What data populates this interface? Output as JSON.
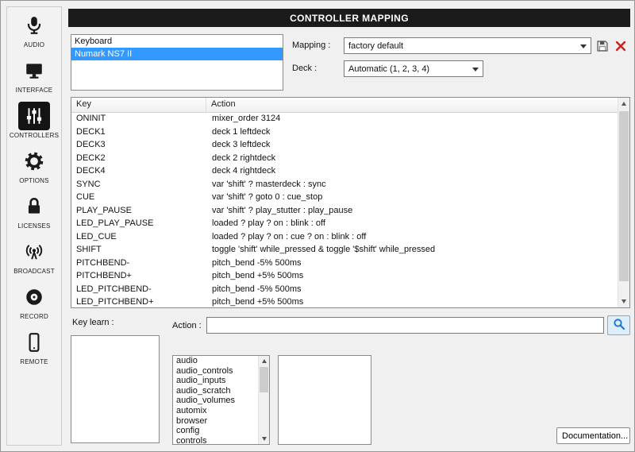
{
  "header": {
    "title": "CONTROLLER MAPPING"
  },
  "sidebar": {
    "items": [
      {
        "label": "AUDIO",
        "icon": "microphone-icon",
        "selected": false
      },
      {
        "label": "INTERFACE",
        "icon": "monitor-icon",
        "selected": false
      },
      {
        "label": "CONTROLLERS",
        "icon": "mixer-sliders-icon",
        "selected": true
      },
      {
        "label": "OPTIONS",
        "icon": "gear-icon",
        "selected": false
      },
      {
        "label": "LICENSES",
        "icon": "lock-icon",
        "selected": false
      },
      {
        "label": "BROADCAST",
        "icon": "broadcast-icon",
        "selected": false
      },
      {
        "label": "RECORD",
        "icon": "record-icon",
        "selected": false
      },
      {
        "label": "REMOTE",
        "icon": "smartphone-icon",
        "selected": false
      }
    ]
  },
  "devices": {
    "items": [
      {
        "label": "Keyboard",
        "selected": false
      },
      {
        "label": "Numark NS7 II",
        "selected": true
      }
    ]
  },
  "mapping": {
    "label": "Mapping :",
    "value": "factory default"
  },
  "deck": {
    "label": "Deck :",
    "value": "Automatic (1, 2, 3, 4)"
  },
  "table": {
    "columns": [
      "Key",
      "Action"
    ],
    "rows": [
      {
        "key": "ONINIT",
        "action": "mixer_order 3124"
      },
      {
        "key": "DECK1",
        "action": "deck 1 leftdeck"
      },
      {
        "key": "DECK3",
        "action": "deck 3 leftdeck"
      },
      {
        "key": "DECK2",
        "action": "deck 2 rightdeck"
      },
      {
        "key": "DECK4",
        "action": "deck 4 rightdeck"
      },
      {
        "key": "SYNC",
        "action": "var 'shift' ? masterdeck : sync"
      },
      {
        "key": "CUE",
        "action": "var 'shift' ? goto 0 : cue_stop"
      },
      {
        "key": "PLAY_PAUSE",
        "action": "var 'shift' ? play_stutter : play_pause"
      },
      {
        "key": "LED_PLAY_PAUSE",
        "action": "loaded ? play ? on : blink : off"
      },
      {
        "key": "LED_CUE",
        "action": "loaded ? play ? on : cue ? on : blink : off"
      },
      {
        "key": "SHIFT",
        "action": "toggle 'shift' while_pressed & toggle '$shift' while_pressed"
      },
      {
        "key": "PITCHBEND-",
        "action": "pitch_bend -5% 500ms"
      },
      {
        "key": "PITCHBEND+",
        "action": "pitch_bend +5% 500ms"
      },
      {
        "key": "LED_PITCHBEND-",
        "action": "pitch_bend -5% 500ms"
      },
      {
        "key": "LED_PITCHBEND+",
        "action": "pitch_bend +5% 500ms"
      }
    ]
  },
  "key_learn": {
    "label": "Key learn :"
  },
  "action": {
    "label": "Action :",
    "value": ""
  },
  "action_categories": [
    "audio",
    "audio_controls",
    "audio_inputs",
    "audio_scratch",
    "audio_volumes",
    "automix",
    "browser",
    "config",
    "controls"
  ],
  "buttons": {
    "documentation": "Documentation..."
  },
  "colors": {
    "accent_blue": "#3399ff",
    "header_bg": "#1b1b1b",
    "delete_red": "#cc2222",
    "search_blue": "#2277cc"
  }
}
